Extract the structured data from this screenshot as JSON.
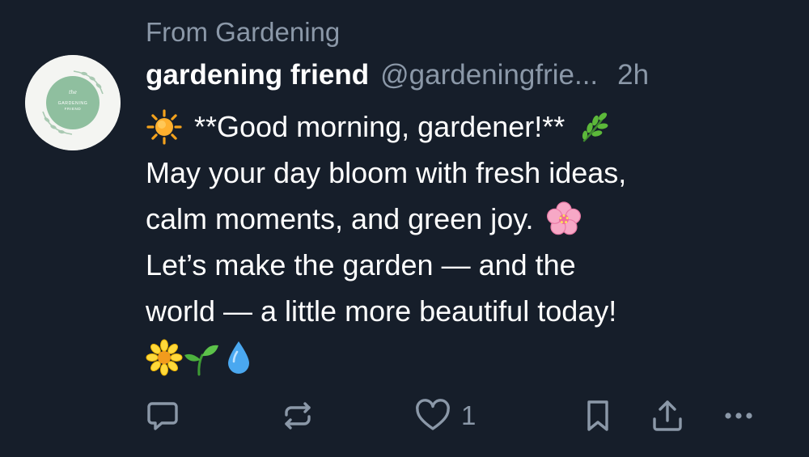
{
  "post": {
    "context": "From Gardening",
    "author": {
      "display_name": "gardening friend",
      "handle": "@gardeningfrie...",
      "avatar_text": "GARDENING FRIEND",
      "avatar_prefix": "the"
    },
    "timestamp": "2h",
    "lines": [
      {
        "emoji_before": "sun-emoji",
        "text": "**Good morning, gardener!**",
        "emoji_after": "herb-emoji"
      },
      {
        "text": "May your day bloom with fresh ideas,"
      },
      {
        "text": "calm moments, and green joy.",
        "emoji_after": "cherry-blossom-emoji"
      },
      {
        "text": "Let’s make the garden — and the"
      },
      {
        "text": "world — a little more beautiful today!"
      },
      {
        "emojis": [
          "blossom-emoji",
          "seedling-emoji",
          "droplet-emoji"
        ]
      }
    ],
    "actions": {
      "reply_icon": "reply-icon",
      "repost_icon": "repost-icon",
      "like_icon": "heart-icon",
      "like_count": "1",
      "bookmark_icon": "bookmark-icon",
      "share_icon": "share-icon",
      "more_icon": "more-icon"
    }
  },
  "colors": {
    "background": "#161e2a",
    "primary_text": "#ffffff",
    "secondary_text": "#8b98a8",
    "avatar_green": "#8fbf9f"
  }
}
